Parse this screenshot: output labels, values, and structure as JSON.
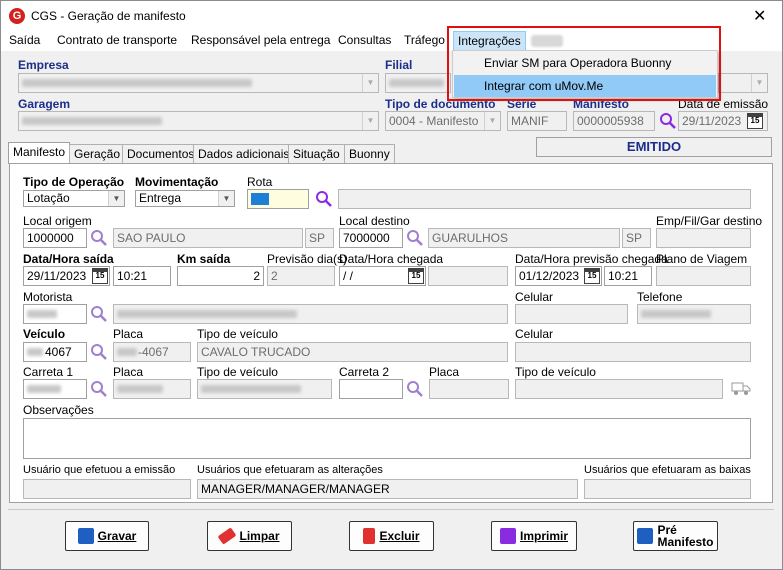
{
  "window": {
    "title": "CGS - Geração de manifesto",
    "close": "✕"
  },
  "menu": {
    "items": [
      "Saída",
      "Contrato de transporte",
      "Responsável pela entrega",
      "Consultas",
      "Tráfego",
      "Integrações"
    ],
    "dropdown": [
      "Enviar SM para Operadora  Buonny",
      "Integrar com uMov.Me"
    ]
  },
  "header": {
    "empresa_label": "Empresa",
    "filial_label": "Filial",
    "garagem_label": "Garagem",
    "tipo_doc_label": "Tipo de documento",
    "tipo_doc_value": "0004 - Manifesto",
    "serie_label": "Série",
    "serie_value": "MANIF",
    "manifesto_label": "Manifesto",
    "manifesto_value": "0000005938",
    "data_emissao_label": "Data de emissão",
    "data_emissao_value": "29/11/2023",
    "status": "EMITIDO"
  },
  "tabs": [
    "Manifesto",
    "Geração",
    "Documentos",
    "Dados adicionais",
    "Situação",
    "Buonny"
  ],
  "form": {
    "tipo_operacao_label": "Tipo de Operação",
    "tipo_operacao_value": "Lotação",
    "movimentacao_label": "Movimentação",
    "movimentacao_value": "Entrega",
    "rota_label": "Rota",
    "local_origem_label": "Local origem",
    "local_origem_code": "1000000",
    "local_origem_city": "SAO PAULO",
    "local_origem_uf": "SP",
    "local_destino_label": "Local destino",
    "local_destino_code": "7000000",
    "local_destino_city": "GUARULHOS",
    "local_destino_uf": "SP",
    "emp_fil_gar_label": "Emp/Fil/Gar destino",
    "data_saida_label": "Data/Hora saída",
    "data_saida_value": "29/11/2023",
    "hora_saida_value": "10:21",
    "km_saida_label": "Km saída",
    "km_saida_value": "2",
    "previsao_dias_label": "Previsão dia(s)",
    "previsao_dias_value": "2",
    "data_chegada_label": "Data/Hora chegada",
    "data_chegada_value": " /  /",
    "data_prev_chegada_label": "Data/Hora previsão chegada",
    "data_prev_chegada_value": "01/12/2023",
    "hora_prev_chegada_value": "10:21",
    "plano_viagem_label": "Plano de Viagem",
    "motorista_label": "Motorista",
    "celular_label": "Celular",
    "telefone_label": "Telefone",
    "veiculo_label": "Veículo",
    "veiculo_value": "4067",
    "placa_label": "Placa",
    "placa_value": "-4067",
    "tipo_veiculo_label": "Tipo de veículo",
    "tipo_veiculo_value": "CAVALO TRUCADO",
    "carreta1_label": "Carreta 1",
    "carreta2_label": "Carreta 2",
    "observacoes_label": "Observações",
    "usuario_emissao_label": "Usuário que efetuou a emissão",
    "usuarios_alteracoes_label": "Usuários que efetuaram as alterações",
    "usuarios_alteracoes_value": "MANAGER/MANAGER/MANAGER",
    "usuarios_baixas_label": "Usuários que efetuaram as baixas"
  },
  "buttons": {
    "gravar": "Gravar",
    "limpar": "Limpar",
    "excluir": "Excluir",
    "imprimir": "Imprimir",
    "pre_manifesto_1": "Pré",
    "pre_manifesto_2": "Manifesto"
  },
  "colors": {
    "accent_red": "#e01010",
    "label_blue": "#1b2e8a",
    "menu_highlight": "#91c9f7",
    "search_purple": "#8a2be2"
  }
}
